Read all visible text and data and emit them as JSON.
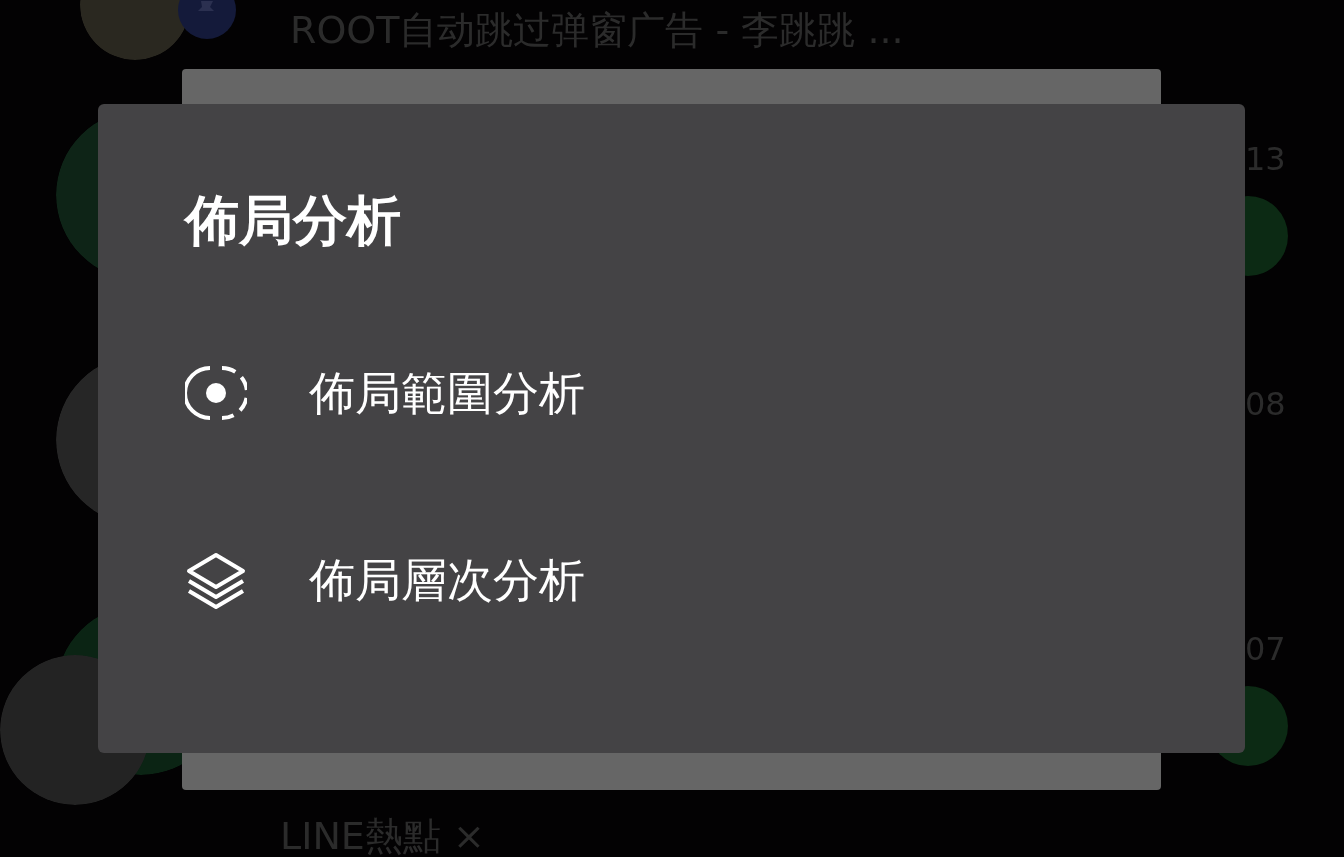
{
  "background_list": {
    "rows": [
      {
        "title": "ROOT自动跳过弹窗广告 - 李跳跳 ..."
      },
      {
        "time": "13",
        "unread": true
      },
      {
        "time": "08"
      },
      {
        "time": "07",
        "unread": true
      },
      {
        "title": "LINE熱點 ×"
      }
    ]
  },
  "dialog": {
    "title": "佈局分析",
    "items": [
      {
        "kind": "range",
        "label": "佈局範圍分析"
      },
      {
        "kind": "layers",
        "label": "佈局層次分析"
      }
    ]
  }
}
